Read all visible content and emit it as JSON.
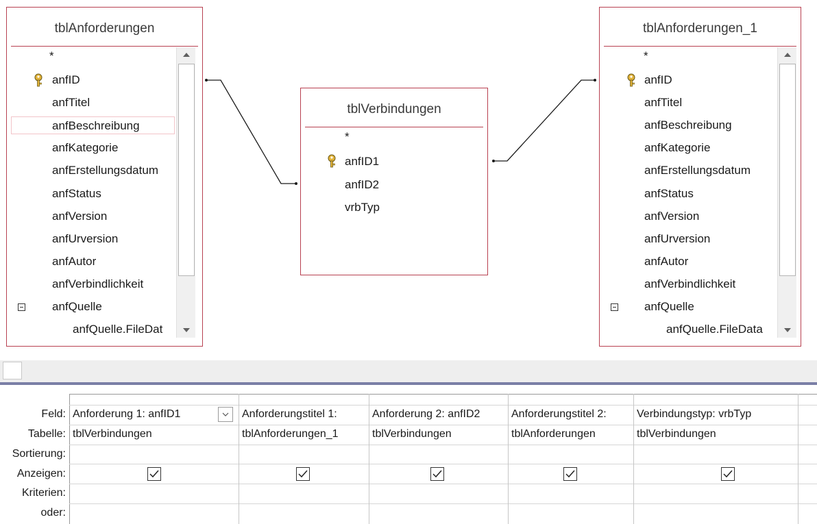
{
  "tables": [
    {
      "title": "tblAnforderungen",
      "fields": [
        "*",
        "anfID",
        "anfTitel",
        "anfBeschreibung",
        "anfKategorie",
        "anfErstellungsdatum",
        "anfStatus",
        "anfVersion",
        "anfUrversion",
        "anfAutor",
        "anfVerbindlichkeit",
        "anfQuelle",
        "anfQuelle.FileDat"
      ]
    },
    {
      "title": "tblVerbindungen",
      "fields": [
        "*",
        "anfID1",
        "anfID2",
        "vrbTyp"
      ]
    },
    {
      "title": "tblAnforderungen_1",
      "fields": [
        "*",
        "anfID",
        "anfTitel",
        "anfBeschreibung",
        "anfKategorie",
        "anfErstellungsdatum",
        "anfStatus",
        "anfVersion",
        "anfUrversion",
        "anfAutor",
        "anfVerbindlichkeit",
        "anfQuelle",
        "anfQuelle.FileData"
      ]
    }
  ],
  "grid": {
    "row_labels": [
      "Feld:",
      "Tabelle:",
      "Sortierung:",
      "Anzeigen:",
      "Kriterien:",
      "oder:"
    ],
    "columns": [
      {
        "field": "Anforderung 1: anfID1",
        "table": "tblVerbindungen",
        "show": true
      },
      {
        "field": "Anforderungstitel 1:",
        "table": "tblAnforderungen_1",
        "show": true
      },
      {
        "field": "Anforderung 2: anfID2",
        "table": "tblVerbindungen",
        "show": true
      },
      {
        "field": "Anforderungstitel 2:",
        "table": "tblAnforderungen",
        "show": true
      },
      {
        "field": "Verbindungstyp: vrbTyp",
        "table": "tblVerbindungen",
        "show": true
      }
    ]
  },
  "icons": {
    "key": "primary-key-icon",
    "collapse": "collapse-minus-icon",
    "scroll_up": "scroll-up-arrow-icon",
    "scroll_down": "scroll-down-arrow-icon",
    "dropdown": "chevron-down-icon",
    "checkbox": "checkmark-icon"
  },
  "colors": {
    "table_border": "#b84050",
    "splitter": "#7a7fa6"
  }
}
